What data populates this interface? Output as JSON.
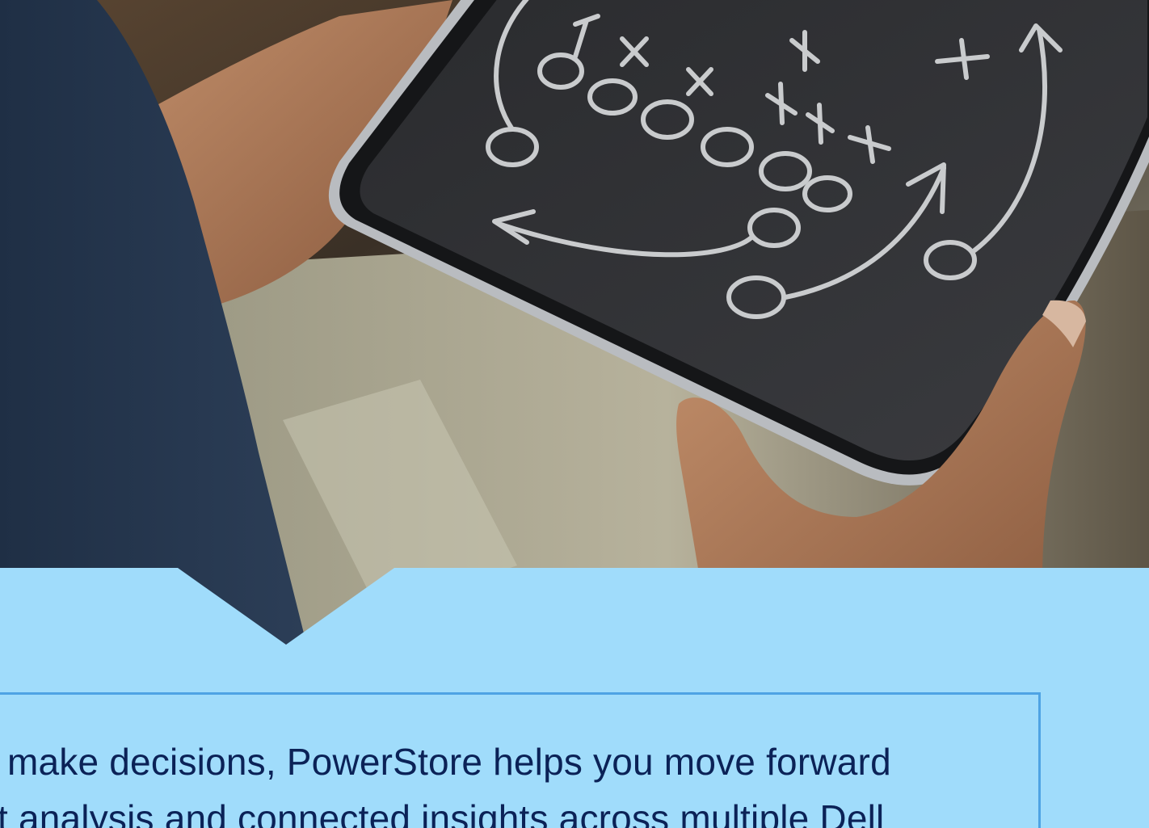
{
  "hero_image": {
    "description_icon": "tablet-play-diagram-image"
  },
  "quote": {
    "line_1": "make decisions, PowerStore helps you move forward",
    "line_2": "t analysis and connected insights across multiple Dell"
  },
  "colors": {
    "panel_background": "#a0dcfb",
    "box_border": "#4ea3e4",
    "text": "#0b2257"
  }
}
